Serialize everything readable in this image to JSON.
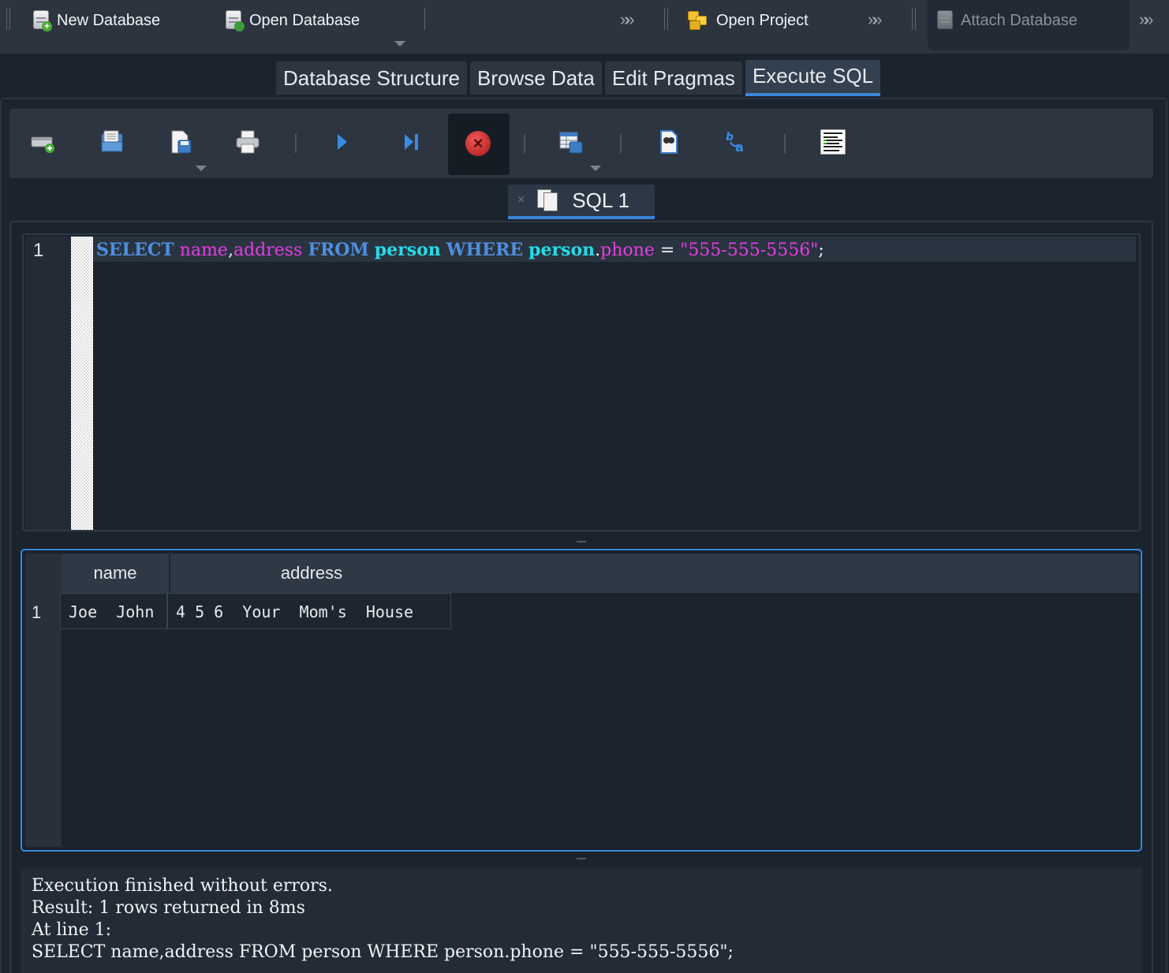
{
  "toolbar": {
    "new_database": "New Database",
    "open_database": "Open Database",
    "open_project": "Open Project",
    "attach_database": "Attach Database"
  },
  "tabs": {
    "database_structure": "Database Structure",
    "browse_data": "Browse Data",
    "edit_pragmas": "Edit Pragmas",
    "execute_sql": "Execute SQL",
    "active": "Execute SQL"
  },
  "sql_toolbar": {
    "icons": [
      "open-tab-icon",
      "open-sql-file-icon",
      "save-sql-file-icon",
      "print-icon",
      "execute-all-icon",
      "execute-line-icon",
      "stop-execution-icon",
      "save-results-icon",
      "find-icon",
      "find-replace-icon",
      "comment-block-icon"
    ]
  },
  "sql_tab": {
    "label": "SQL 1",
    "close": "×"
  },
  "editor": {
    "line_number": "1",
    "tokens": {
      "select": "SELECT",
      "name": "name",
      "comma": ",",
      "address": "address",
      "from": "FROM",
      "person1": "person",
      "where": "WHERE",
      "person2": "person",
      "dot": ".",
      "phone": "phone",
      "eq": "=",
      "str": "\"555-555-5556\"",
      "semi": ";"
    },
    "colors": {
      "keyword": "#4d8fe0",
      "identifier": "#e43ee4",
      "table": "#23dde8",
      "string": "#e43ee4"
    }
  },
  "results": {
    "columns": [
      "name",
      "address"
    ],
    "rows": [
      {
        "num": "1",
        "name": "Joe  John",
        "address": "4 5 6  Your  Mom's  House"
      }
    ]
  },
  "messages": {
    "line1": "Execution finished without errors.",
    "line2": "Result: 1 rows returned in 8ms",
    "line3": "At line 1:",
    "line4": "SELECT name,address FROM person WHERE person.phone = \"555-555-5556\";"
  },
  "accent_color": "#3a86d8"
}
